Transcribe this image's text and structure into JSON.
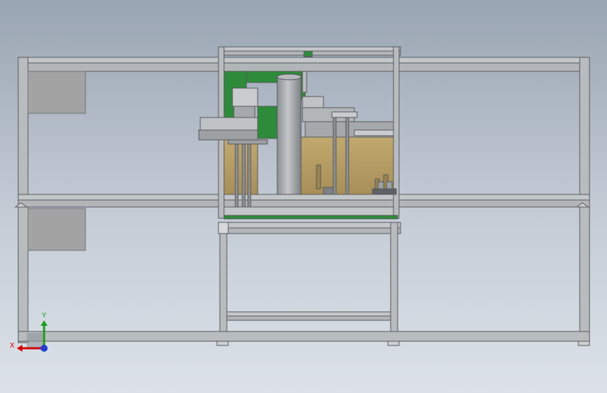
{
  "viewport": {
    "background_top": "#9aa5b3",
    "background_bottom": "#dde2e9"
  },
  "colors": {
    "frame": "#b9bcbf",
    "frame_dark": "#6e7174",
    "panel": "#a3a3a3",
    "green_plate": "#2e8b3a",
    "tan_plate": "#b59d63",
    "cylinder": "#a9abaf"
  },
  "triad": {
    "x_label": "X",
    "y_label": "Y",
    "x_color": "#d40000",
    "y_color": "#1aa01a",
    "z_color": "#1f3fd6"
  }
}
